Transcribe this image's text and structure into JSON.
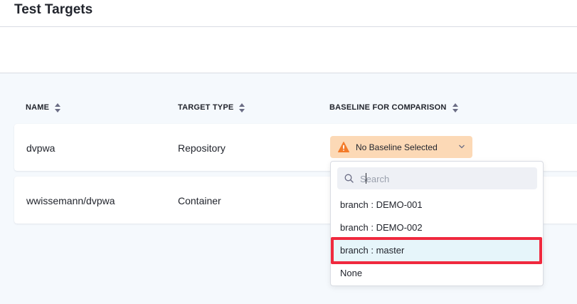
{
  "page": {
    "title": "Test Targets"
  },
  "table": {
    "columns": [
      {
        "label": "NAME"
      },
      {
        "label": "TARGET TYPE"
      },
      {
        "label": "BASELINE FOR COMPARISON"
      }
    ],
    "rows": [
      {
        "name": "dvpwa",
        "type": "Repository",
        "baseline": "No Baseline Selected"
      },
      {
        "name": "wwissemann/dvpwa",
        "type": "Container"
      }
    ]
  },
  "dropdown": {
    "search_placeholder": "Search",
    "options": [
      "branch : DEMO-001",
      "branch : DEMO-002",
      "branch : master",
      "None"
    ],
    "highlighted_index": 2
  },
  "colors": {
    "baseline_warning_bg": "#fcd9b6",
    "warning_icon": "#f37b2a",
    "annotation": "#f0293e",
    "highlight": "#e6f5fa"
  }
}
